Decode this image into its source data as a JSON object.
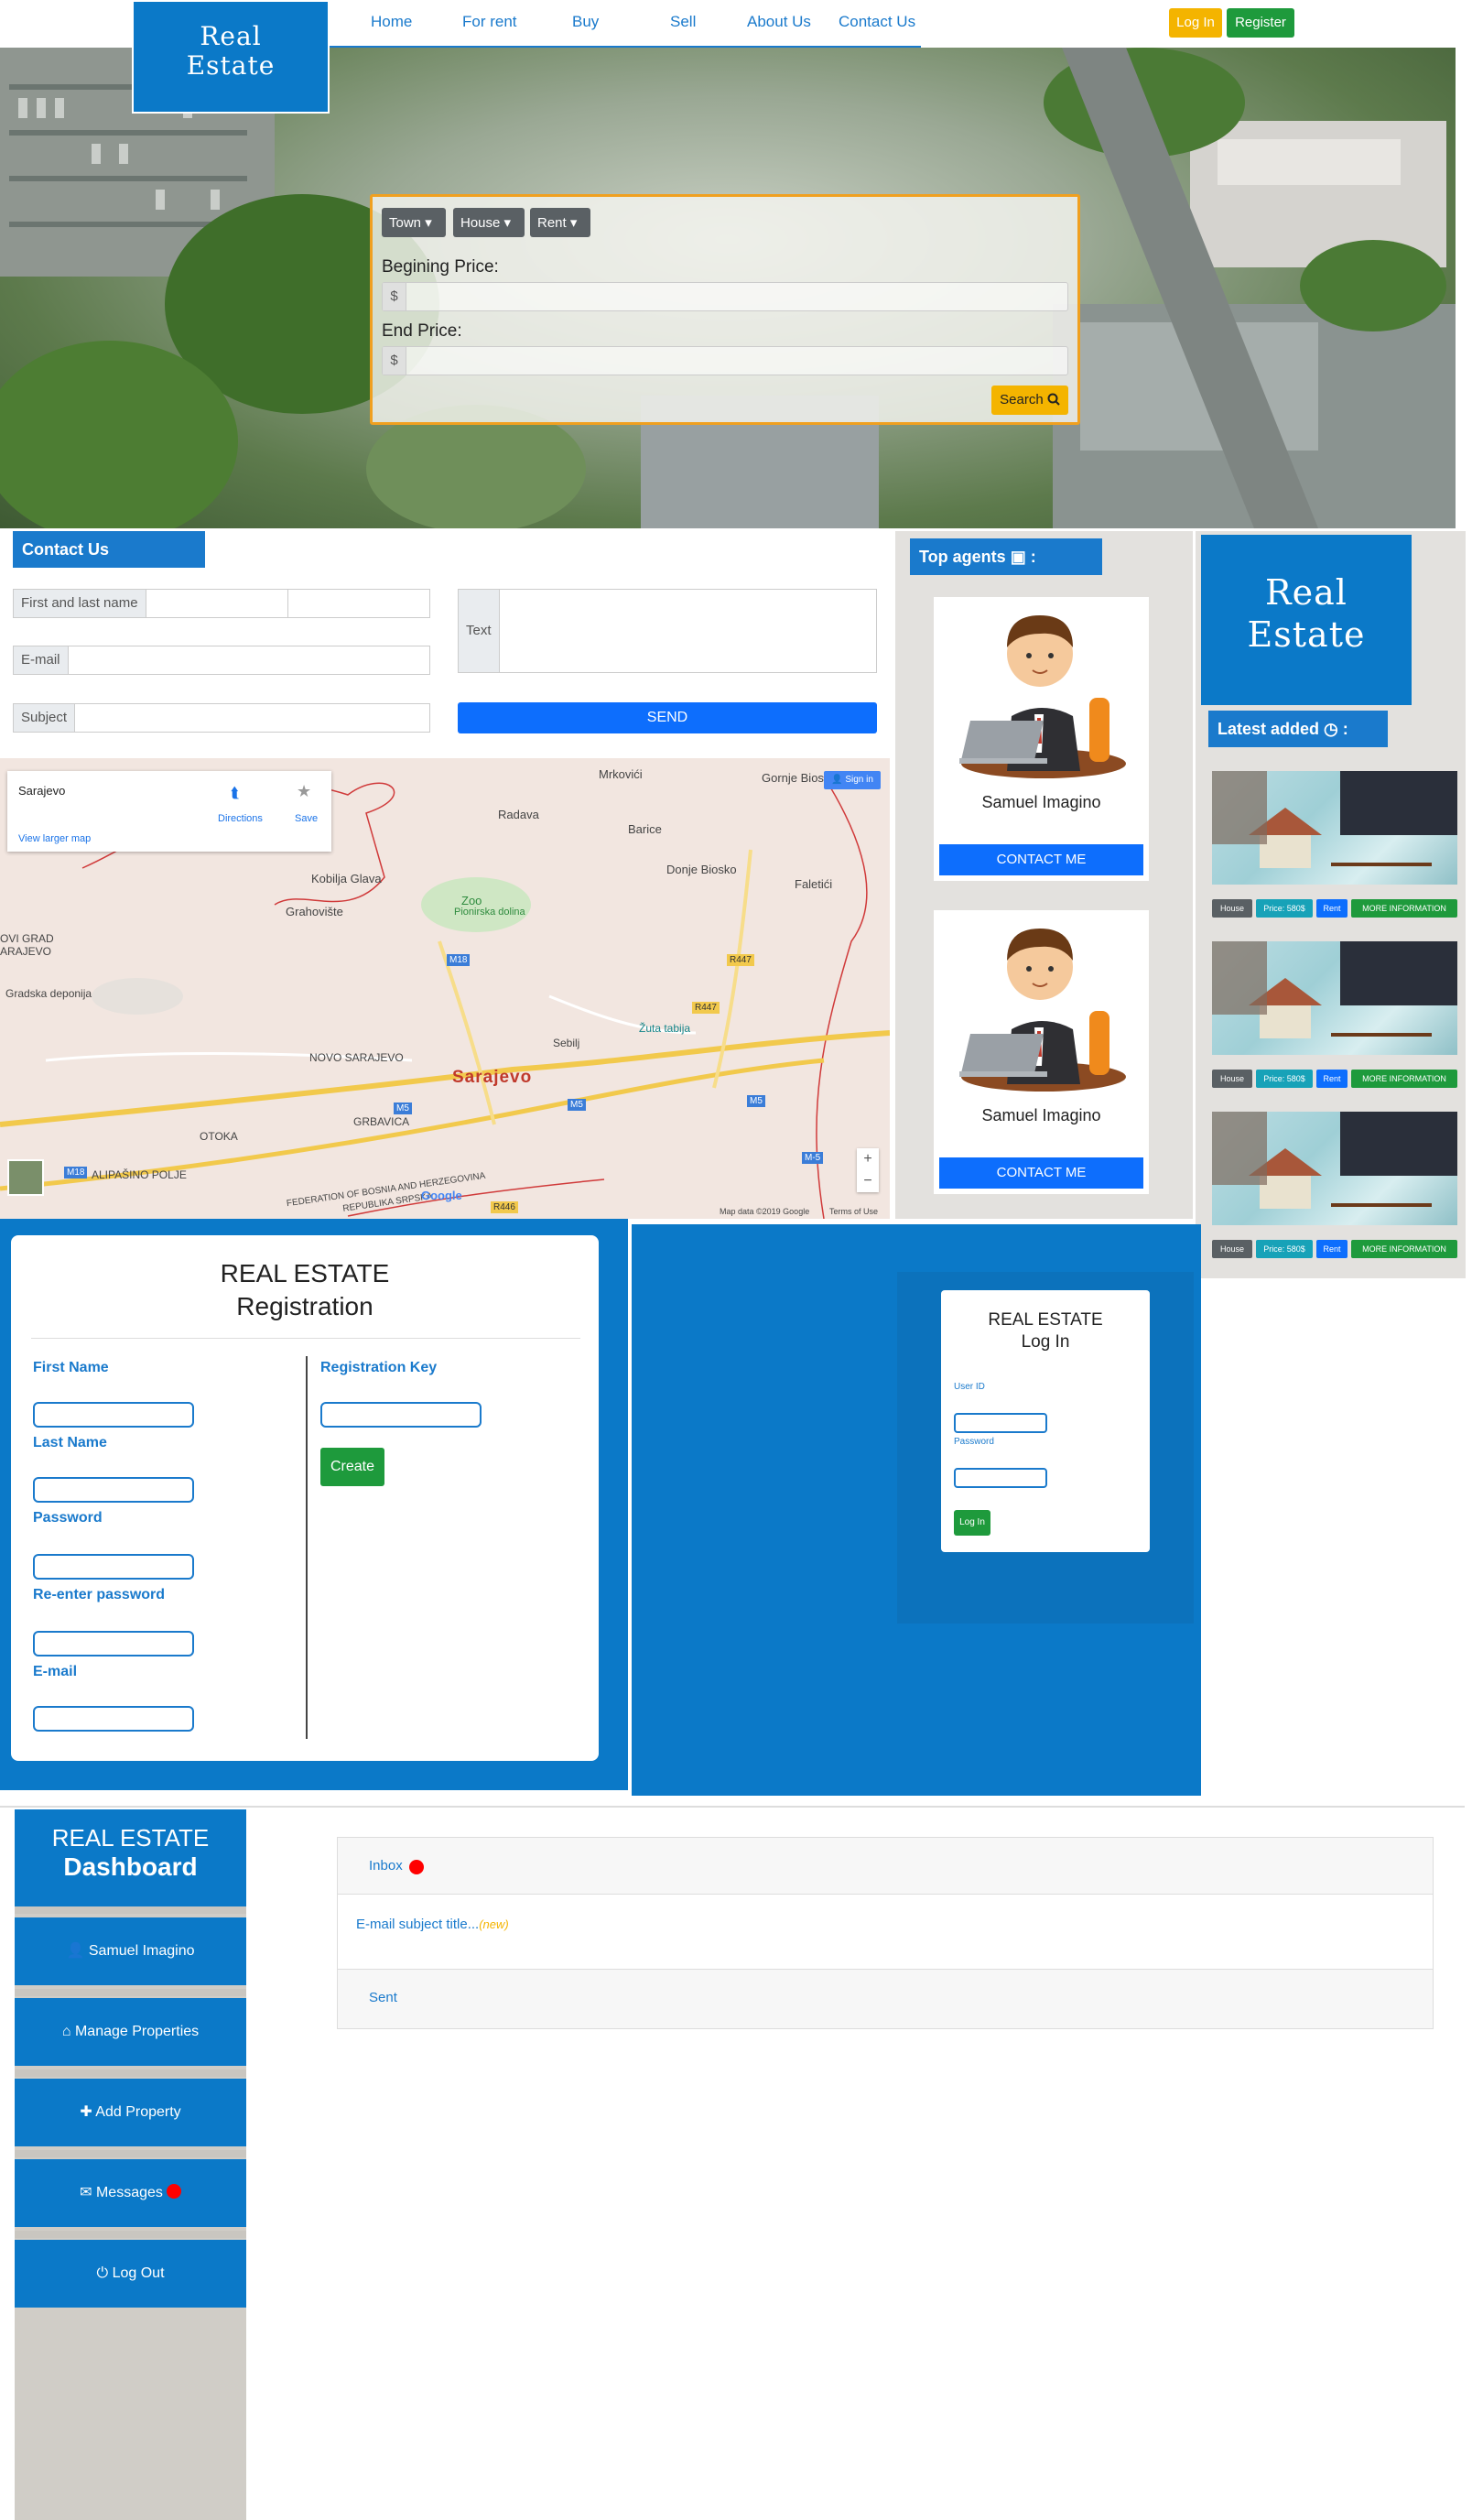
{
  "nav": {
    "logo_line1": "Real",
    "logo_line2": "Estate",
    "links": [
      "Home",
      "For rent",
      "Buy",
      "Sell",
      "About Us",
      "Contact Us"
    ],
    "login_label": "Log In",
    "register_label": "Register"
  },
  "search": {
    "town_label": "Town",
    "house_label": "House",
    "rent_label": "Rent",
    "begin_price_label": "Begining Price:",
    "end_price_label": "End Price:",
    "currency": "$",
    "search_label": "Search"
  },
  "contact": {
    "title": "Contact Us",
    "name_label": "First and last name",
    "email_label": "E-mail",
    "subject_label": "Subject",
    "text_label": "Text",
    "send_label": "SEND"
  },
  "map": {
    "place_name": "Sarajevo",
    "directions_label": "Directions",
    "save_label": "Save",
    "view_larger": "View larger map",
    "signin_label": "Sign in",
    "zoom_in": "+",
    "zoom_out": "−",
    "google_label": "Google",
    "footer_data": "Map data ©2019 Google",
    "footer_terms": "Terms of Use",
    "city_label": "Sarajevo",
    "towns": [
      "Mrkovići",
      "Gornje Biosko",
      "Radava",
      "Barice",
      "Donje Biosko",
      "Faletići",
      "Kobilja Glava",
      "Grahovište",
      "Zoo",
      "Pionirska dolina",
      "OVI GRAD",
      "ARAJEVO",
      "Gradska deponija",
      "NOVO SARAJEVO",
      "Sebilj",
      "Žuta tabija",
      "GRBAVICA",
      "OTOKA",
      "ALIPAŠINO POLJE",
      "FEDERATION OF BOSNIA AND HERZEGOVINA",
      "REPUBLIKA SRPSKA"
    ],
    "roads": [
      "M18",
      "M5",
      "M5",
      "M5",
      "R447",
      "R447",
      "R446",
      "M-5",
      "M18"
    ]
  },
  "agents": {
    "title": "Top agents",
    "list": [
      {
        "name": "Samuel Imagino",
        "contact_label": "CONTACT ME"
      },
      {
        "name": "Samuel Imagino",
        "contact_label": "CONTACT ME"
      }
    ]
  },
  "side_logo": {
    "line1": "Real",
    "line2": "Estate"
  },
  "latest": {
    "title": "Latest added",
    "items": [
      {
        "type": "House",
        "price": "Price: 580$",
        "mode": "Rent",
        "info": "MORE INFORMATION"
      },
      {
        "type": "House",
        "price": "Price: 580$",
        "mode": "Rent",
        "info": "MORE INFORMATION"
      },
      {
        "type": "House",
        "price": "Price: 580$",
        "mode": "Rent",
        "info": "MORE INFORMATION"
      }
    ]
  },
  "registration": {
    "title_line1": "REAL ESTATE",
    "title_line2": "Registration",
    "first_name": "First Name",
    "last_name": "Last Name",
    "password": "Password",
    "re_password": "Re-enter password",
    "email": "E-mail",
    "reg_key": "Registration Key",
    "create_label": "Create"
  },
  "login": {
    "title_line1": "REAL ESTATE",
    "title_line2": "Log In",
    "user_id": "User ID",
    "password": "Password",
    "login_label": "Log In"
  },
  "dashboard": {
    "title_line1": "REAL ESTATE",
    "title_line2": "Dashboard",
    "items": [
      "Samuel Imagino",
      "Manage Properties",
      "Add Property",
      "Messages",
      "Log Out"
    ],
    "inbox_label": "Inbox",
    "email_subject": "E-mail subject title...",
    "email_new": "(new)",
    "sent_label": "Sent"
  },
  "colors": {
    "brand_blue": "#0b79c8",
    "accent_yellow": "#f4b400",
    "accent_green": "#1e9a3c",
    "button_blue": "#0d6efd",
    "notify_red": "#ff0000"
  }
}
